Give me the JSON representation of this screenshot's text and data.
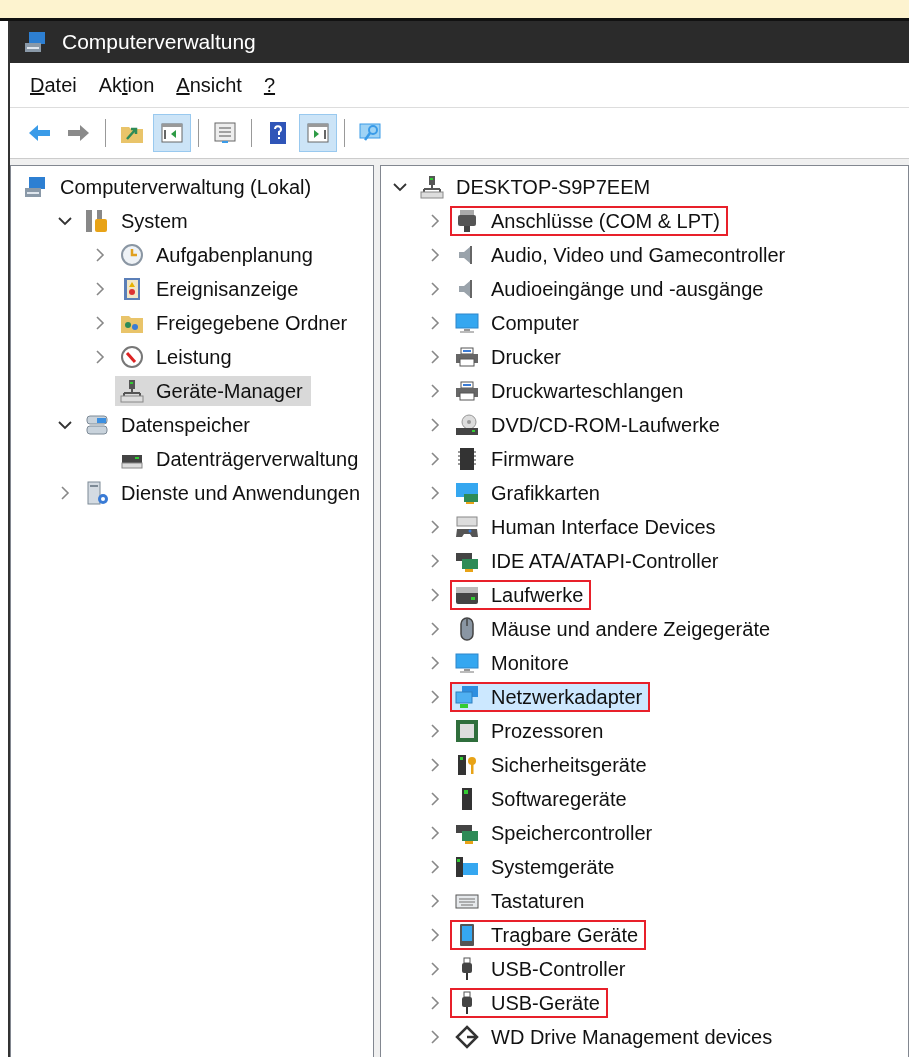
{
  "window": {
    "title": "Computerverwaltung"
  },
  "menu": [
    {
      "key": "D",
      "after": "atei"
    },
    {
      "before": "Ak",
      "key": "t",
      "after": "ion"
    },
    {
      "key": "A",
      "after": "nsicht"
    },
    {
      "key": "?"
    }
  ],
  "toolbar": [
    {
      "kind": "back",
      "pressed": false
    },
    {
      "kind": "forward",
      "pressed": false
    },
    {
      "kind": "separator"
    },
    {
      "kind": "up",
      "pressed": false
    },
    {
      "kind": "tree",
      "pressed": true
    },
    {
      "kind": "separator"
    },
    {
      "kind": "properties",
      "pressed": false
    },
    {
      "kind": "separator"
    },
    {
      "kind": "help",
      "pressed": false
    },
    {
      "kind": "actions",
      "pressed": true
    },
    {
      "kind": "separator"
    },
    {
      "kind": "monitor",
      "pressed": false
    }
  ],
  "left_pane": {
    "tree": [
      {
        "label": "Computerverwaltung (Lokal)",
        "kind": "management",
        "selected": false,
        "highlighted": false,
        "children": [
          {
            "label": "System",
            "kind": "tools",
            "expanded": true,
            "selected": false,
            "highlighted": false,
            "children": [
              {
                "label": "Aufgabenplanung",
                "kind": "clock",
                "expanded": false,
                "selected": false,
                "highlighted": false
              },
              {
                "label": "Ereignisanzeige",
                "kind": "eventlog",
                "expanded": false,
                "selected": false,
                "highlighted": false
              },
              {
                "label": "Freigegebene Ordner",
                "kind": "shared",
                "expanded": false,
                "selected": false,
                "highlighted": false
              },
              {
                "label": "Leistung",
                "kind": "gauge",
                "expanded": false,
                "selected": false,
                "highlighted": false
              },
              {
                "label": "Geräte-Manager",
                "kind": "devmgr",
                "selected": true,
                "highlighted": false
              }
            ]
          },
          {
            "label": "Datenspeicher",
            "kind": "storage",
            "expanded": true,
            "selected": false,
            "highlighted": false,
            "children": [
              {
                "label": "Datenträgerverwaltung",
                "kind": "disk",
                "selected": false,
                "highlighted": false
              }
            ]
          },
          {
            "label": "Dienste und Anwendungen",
            "kind": "services",
            "expanded": false,
            "selected": false,
            "highlighted": false
          }
        ]
      }
    ]
  },
  "right_pane": {
    "tree": [
      {
        "label": "DESKTOP-S9P7EEM",
        "kind": "devmgr",
        "expanded": true,
        "selected": false,
        "highlighted": false,
        "children": [
          {
            "label": "Anschlüsse (COM & LPT)",
            "kind": "port",
            "expanded": false,
            "selected": false,
            "highlighted": true
          },
          {
            "label": "Audio, Video und Gamecontroller",
            "kind": "speaker",
            "expanded": false,
            "selected": false,
            "highlighted": false
          },
          {
            "label": "Audioeingänge und -ausgänge",
            "kind": "speaker",
            "expanded": false,
            "selected": false,
            "highlighted": false
          },
          {
            "label": "Computer",
            "kind": "monitor",
            "expanded": false,
            "selected": false,
            "highlighted": false
          },
          {
            "label": "Drucker",
            "kind": "printer",
            "expanded": false,
            "selected": false,
            "highlighted": false
          },
          {
            "label": "Druckwarteschlangen",
            "kind": "printer",
            "expanded": false,
            "selected": false,
            "highlighted": false
          },
          {
            "label": "DVD/CD-ROM-Laufwerke",
            "kind": "disc",
            "expanded": false,
            "selected": false,
            "highlighted": false
          },
          {
            "label": "Firmware",
            "kind": "chip",
            "expanded": false,
            "selected": false,
            "highlighted": false
          },
          {
            "label": "Grafikkarten",
            "kind": "graphics",
            "expanded": false,
            "selected": false,
            "highlighted": false
          },
          {
            "label": "Human Interface Devices",
            "kind": "hid",
            "expanded": false,
            "selected": false,
            "highlighted": false
          },
          {
            "label": "IDE ATA/ATAPI-Controller",
            "kind": "card",
            "expanded": false,
            "selected": false,
            "highlighted": false
          },
          {
            "label": "Laufwerke",
            "kind": "drive",
            "expanded": false,
            "selected": false,
            "highlighted": true
          },
          {
            "label": "Mäuse und andere Zeigegeräte",
            "kind": "mouse",
            "expanded": false,
            "selected": false,
            "highlighted": false
          },
          {
            "label": "Monitore",
            "kind": "monitor",
            "expanded": false,
            "selected": false,
            "highlighted": false
          },
          {
            "label": "Netzwerkadapter",
            "kind": "network",
            "expanded": false,
            "selected": true,
            "highlighted": true
          },
          {
            "label": "Prozessoren",
            "kind": "processor",
            "expanded": false,
            "selected": false,
            "highlighted": false
          },
          {
            "label": "Sicherheitsgeräte",
            "kind": "security",
            "expanded": false,
            "selected": false,
            "highlighted": false
          },
          {
            "label": "Softwaregeräte",
            "kind": "tower",
            "expanded": false,
            "selected": false,
            "highlighted": false
          },
          {
            "label": "Speichercontroller",
            "kind": "card",
            "expanded": false,
            "selected": false,
            "highlighted": false
          },
          {
            "label": "Systemgeräte",
            "kind": "system",
            "expanded": false,
            "selected": false,
            "highlighted": false
          },
          {
            "label": "Tastaturen",
            "kind": "keyboard",
            "expanded": false,
            "selected": false,
            "highlighted": false
          },
          {
            "label": "Tragbare Geräte",
            "kind": "tablet",
            "expanded": false,
            "selected": false,
            "highlighted": true
          },
          {
            "label": "USB-Controller",
            "kind": "usb",
            "expanded": false,
            "selected": false,
            "highlighted": false
          },
          {
            "label": "USB-Geräte",
            "kind": "usb",
            "expanded": false,
            "selected": false,
            "highlighted": true
          },
          {
            "label": "WD Drive Management devices",
            "kind": "diamond",
            "expanded": false,
            "selected": false,
            "highlighted": false
          }
        ]
      }
    ]
  }
}
